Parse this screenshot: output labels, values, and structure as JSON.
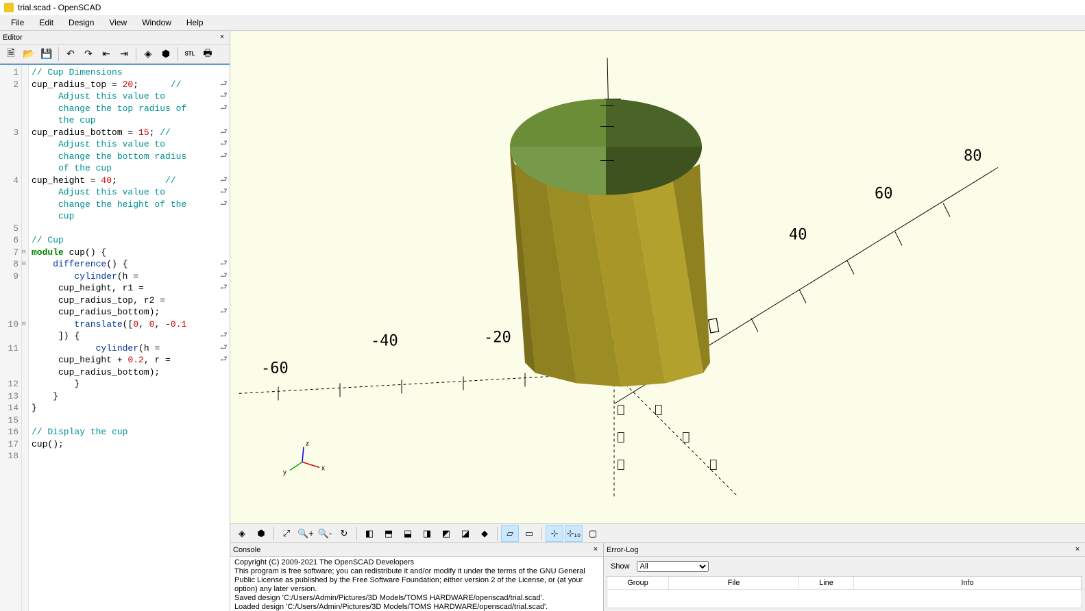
{
  "title": "trial.scad - OpenSCAD",
  "menu": {
    "file": "File",
    "edit": "Edit",
    "design": "Design",
    "view": "View",
    "window": "Window",
    "help": "Help"
  },
  "editor": {
    "label": "Editor",
    "toolbar": {
      "new": "new",
      "open": "open",
      "save": "save",
      "undo": "undo",
      "redo": "redo",
      "unindent": "unindent",
      "indent": "indent",
      "preview": "preview",
      "render": "render",
      "stl": "STL",
      "print": "print"
    }
  },
  "code": {
    "gutter": " 1\n 2\n  \n  \n  \n 3\n  \n  \n  \n 4\n  \n  \n  \n 5\n 6\n 7\n 8\n 9\n  \n  \n  \n10\n  \n11\n  \n  \n12\n13\n14\n15\n16\n17\n18",
    "fold": " \n \n \n \n \n \n \n \n \n \n \n \n \n \n \n⊟\n⊟\n \n \n \n \n⊟\n \n \n \n \n \n \n \n \n \n \n "
  },
  "code_lines": {
    "l1": "// Cup Dimensions",
    "l2a": "cup_radius_top = ",
    "l2n": "20",
    "l2b": ";      ",
    "l2c": "// ",
    "l2d": "     Adjust this value to ",
    "l2e": "     change the top radius of ",
    "l2f": "     the cup",
    "l3a": "cup_radius_bottom = ",
    "l3n": "15",
    "l3b": "; ",
    "l3c": "// ",
    "l3d": "     Adjust this value to ",
    "l3e": "     change the bottom radius ",
    "l3f": "     of the cup",
    "l4a": "cup_height = ",
    "l4n": "40",
    "l4b": ";         ",
    "l4c": "// ",
    "l4d": "     Adjust this value to ",
    "l4e": "     change the height of the ",
    "l4f": "     cup",
    "l5": "",
    "l6": "// Cup",
    "l7a": "module",
    "l7b": " cup() {",
    "l8a": "    ",
    "l8b": "difference",
    "l8c": "() {",
    "l9a": "        ",
    "l9b": "cylinder",
    "l9c": "(h = ",
    "l9d": "     cup_height, r1 = ",
    "l9e": "     cup_radius_top, r2 = ",
    "l9f": "     cup_radius_bottom);",
    "l10a": "        ",
    "l10b": "translate",
    "l10c": "([",
    "l10n1": "0",
    "l10d": ", ",
    "l10n2": "0",
    "l10e": ", -",
    "l10n3": "0.1",
    "l10f": "     ]) {",
    "l11a": "            ",
    "l11b": "cylinder",
    "l11c": "(h = ",
    "l11d": "     cup_height + ",
    "l11n": "0.2",
    "l11e": ", r = ",
    "l11f": "     cup_radius_bottom);",
    "l12": "        }",
    "l13": "    }",
    "l14": "}",
    "l15": "",
    "l16": "// Display the cup",
    "l17": "cup();",
    "l18": ""
  },
  "viewport": {
    "axis_ticks_pos": [
      "40",
      "60",
      "80"
    ],
    "axis_ticks_neg": [
      "-20",
      "-40",
      "-60"
    ],
    "axis_labels": {
      "x": "x",
      "y": "y",
      "z": "z"
    }
  },
  "view_toolbar": [
    "preview",
    "render",
    "zoom-all",
    "zoom-in",
    "zoom-out",
    "reset-view",
    "view-right",
    "view-top",
    "view-bottom",
    "view-left",
    "view-front",
    "view-back",
    "view-diag",
    "perspective",
    "ortho",
    "axes",
    "scale-axes",
    "crosshair"
  ],
  "console": {
    "label": "Console",
    "lines": [
      "Copyright (C) 2009-2021 The OpenSCAD Developers",
      "This program is free software; you can redistribute it and/or modify it under the terms of the GNU General Public License as published by the Free Software Foundation; either version 2 of the License, or (at your option) any later version.",
      "",
      "Saved design 'C:/Users/Admin/Pictures/3D Models/TOMS HARDWARE/openscad/trial.scad'.",
      "Loaded design 'C:/Users/Admin/Pictures/3D Models/TOMS HARDWARE/openscad/trial.scad'."
    ]
  },
  "errorlog": {
    "label": "Error-Log",
    "show_label": "Show",
    "filter": "All",
    "cols": {
      "group": "Group",
      "file": "File",
      "line": "Line",
      "info": "Info"
    }
  }
}
